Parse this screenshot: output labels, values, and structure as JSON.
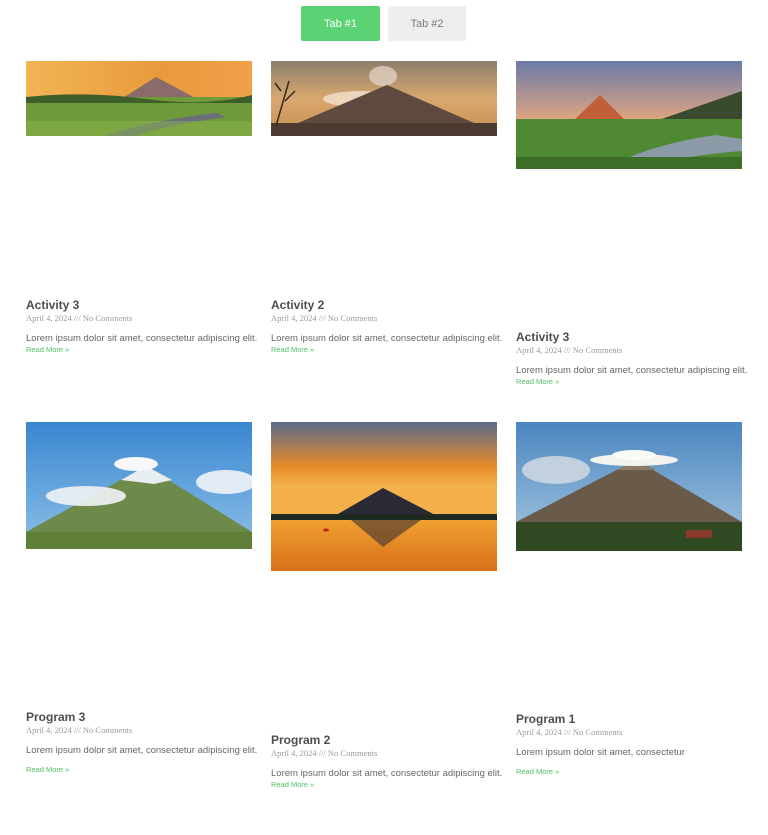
{
  "tabs": [
    {
      "label": "Tab #1",
      "active": true
    },
    {
      "label": "Tab #2",
      "active": false
    }
  ],
  "colors": {
    "accent": "#5bd375",
    "link": "#4cc066"
  },
  "posts": [
    {
      "title": "Activity 3",
      "date": "April 4, 2024",
      "separator": "///",
      "comments": "No Comments",
      "excerpt": "Lorem ipsum dolor sit amet, consectetur adipiscing elit.",
      "read_more": "Read More »"
    },
    {
      "title": "Activity 2",
      "date": "April 4, 2024",
      "separator": "///",
      "comments": "No Comments",
      "excerpt": "Lorem ipsum dolor sit amet, consectetur adipiscing elit.",
      "read_more": "Read More »"
    },
    {
      "title": "Activity 3",
      "date": "April 4, 2024",
      "separator": "///",
      "comments": "No Comments",
      "excerpt": "Lorem ipsum dolor sit amet, consectetur adipiscing elit.",
      "read_more": "Read More »"
    },
    {
      "title": "Program 3",
      "date": "April 4, 2024",
      "separator": "///",
      "comments": "No Comments",
      "excerpt": "Lorem ipsum dolor sit amet, consectetur adipiscing elit.",
      "read_more": "Read More »"
    },
    {
      "title": "Program 2",
      "date": "April 4, 2024",
      "separator": "///",
      "comments": "No Comments",
      "excerpt": "Lorem ipsum dolor sit amet, consectetur adipiscing elit.",
      "read_more": "Read More »"
    },
    {
      "title": "Program 1",
      "date": "April 4, 2024",
      "separator": "///",
      "comments": "No Comments",
      "excerpt": "Lorem ipsum dolor sit amet, consectetur",
      "read_more": "Read More »"
    }
  ]
}
